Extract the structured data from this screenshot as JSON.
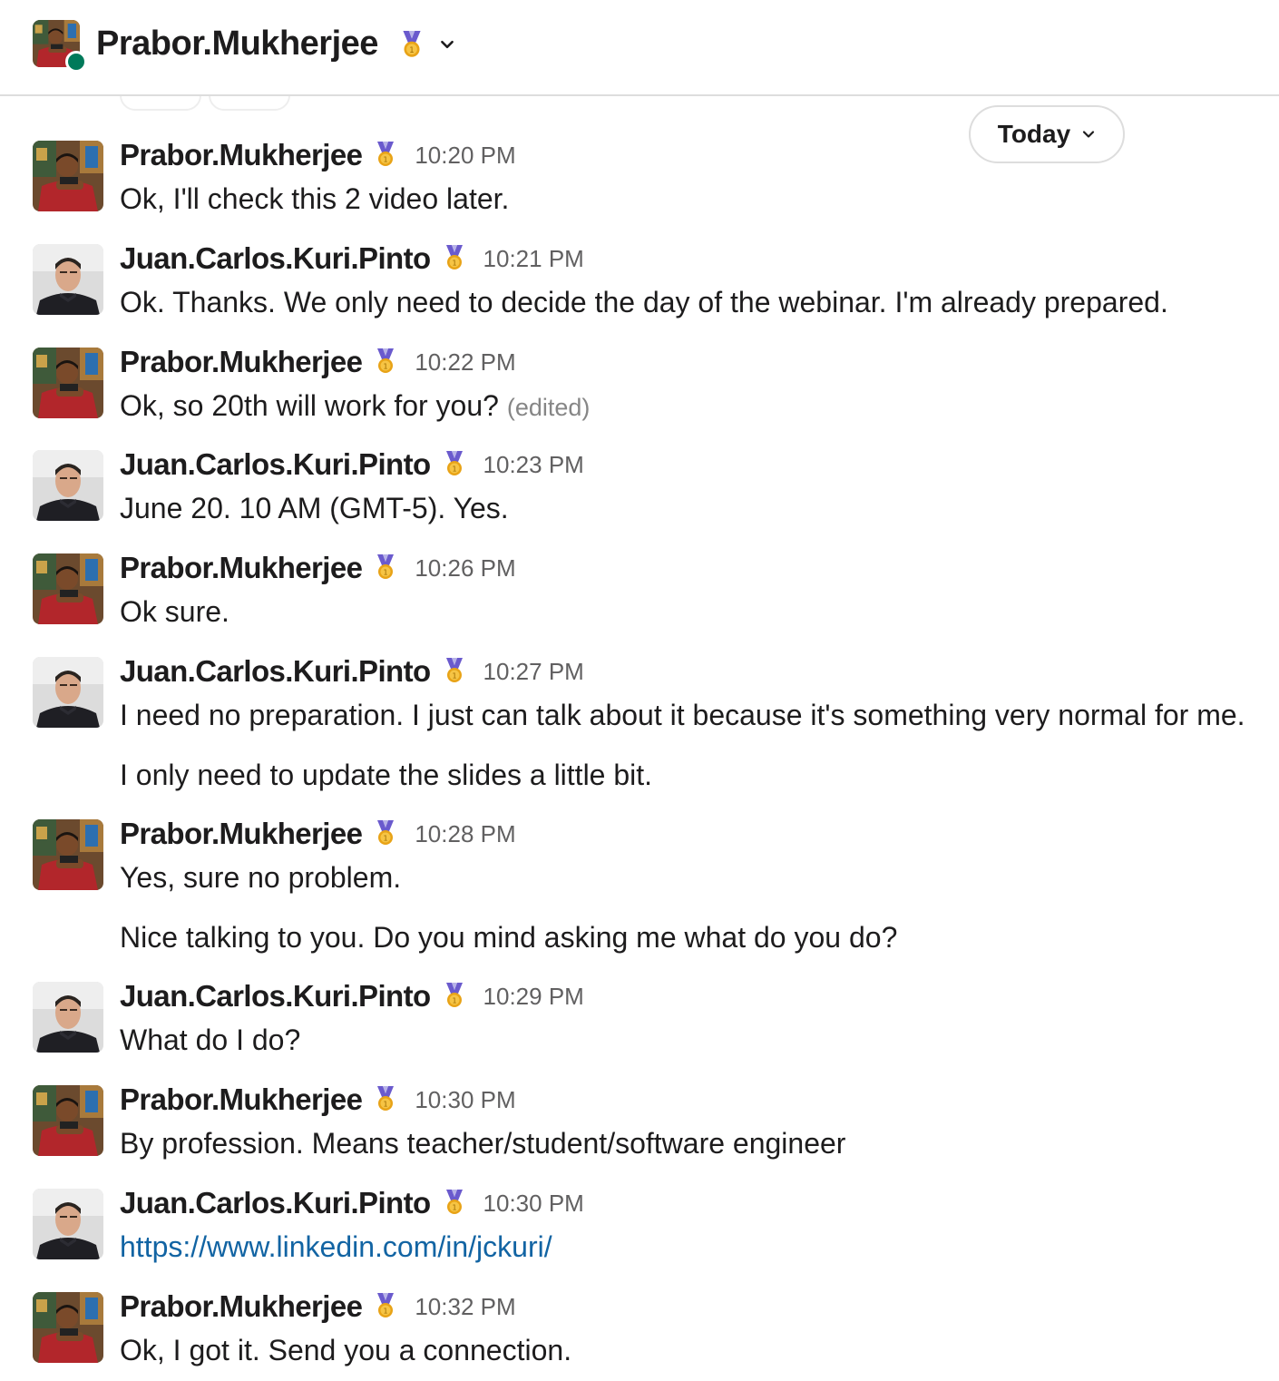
{
  "header": {
    "name": "Prabor.Mukherjee",
    "badge_icon": "medal-icon",
    "chevron_icon": "chevron-down-icon",
    "presence": "online"
  },
  "date_divider": {
    "label": "Today"
  },
  "colors": {
    "link": "#1264a3",
    "presence": "#007a5a",
    "timestamp": "#616061",
    "edited": "#868686"
  },
  "messages": [
    {
      "author": "Prabor.Mukherjee",
      "time": "10:20 PM",
      "lines": [
        "Ok, I'll check this 2 video later."
      ]
    },
    {
      "author": "Juan.Carlos.Kuri.Pinto",
      "time": "10:21 PM",
      "lines": [
        "Ok. Thanks. We only need to decide the day of the webinar. I'm already prepared."
      ]
    },
    {
      "author": "Prabor.Mukherjee",
      "time": "10:22 PM",
      "lines": [
        "Ok, so 20th will work for you?"
      ],
      "edited": "(edited)"
    },
    {
      "author": "Juan.Carlos.Kuri.Pinto",
      "time": "10:23 PM",
      "lines": [
        "June 20. 10 AM (GMT-5). Yes."
      ]
    },
    {
      "author": "Prabor.Mukherjee",
      "time": "10:26 PM",
      "lines": [
        "Ok sure."
      ]
    },
    {
      "author": "Juan.Carlos.Kuri.Pinto",
      "time": "10:27 PM",
      "lines": [
        "I need no preparation. I just can talk about it because it's something very normal for me.",
        "I only need to update the slides a little bit."
      ]
    },
    {
      "author": "Prabor.Mukherjee",
      "time": "10:28 PM",
      "lines": [
        "Yes, sure no problem.",
        "Nice talking to you. Do you mind asking me what do you do?"
      ]
    },
    {
      "author": "Juan.Carlos.Kuri.Pinto",
      "time": "10:29 PM",
      "lines": [
        "What do I do?"
      ]
    },
    {
      "author": "Prabor.Mukherjee",
      "time": "10:30 PM",
      "lines": [
        "By profession. Means teacher/student/software engineer"
      ]
    },
    {
      "author": "Juan.Carlos.Kuri.Pinto",
      "time": "10:30 PM",
      "lines": [
        "https://www.linkedin.com/in/jckuri/"
      ],
      "link": true
    },
    {
      "author": "Prabor.Mukherjee",
      "time": "10:32 PM",
      "lines": [
        "Ok, I got it. Send you a connection."
      ]
    }
  ]
}
